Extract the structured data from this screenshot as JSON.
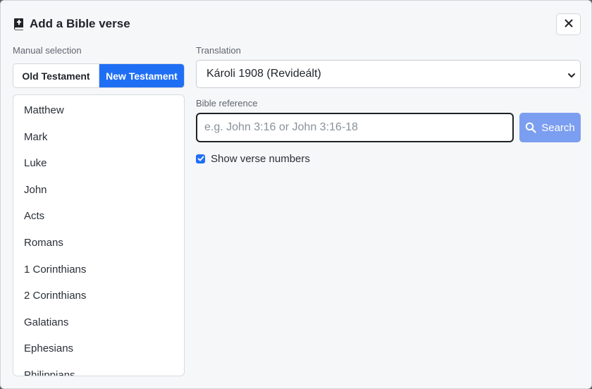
{
  "dialog": {
    "title": "Add a Bible verse",
    "title_icon": "bible-book-icon",
    "close_icon": "close-icon"
  },
  "manual_selection": {
    "label": "Manual selection",
    "tabs": [
      {
        "label": "Old Testament",
        "active": false
      },
      {
        "label": "New Testament",
        "active": true
      }
    ],
    "books": [
      "Matthew",
      "Mark",
      "Luke",
      "John",
      "Acts",
      "Romans",
      "1 Corinthians",
      "2 Corinthians",
      "Galatians",
      "Ephesians",
      "Philippians"
    ]
  },
  "translation": {
    "label": "Translation",
    "selected": "Károli 1908 (Revideált)"
  },
  "reference": {
    "label": "Bible reference",
    "value": "",
    "placeholder": "e.g. John 3:16 or John 3:16-18",
    "search_label": "Search",
    "search_icon": "search-icon"
  },
  "options": {
    "show_verse_numbers_label": "Show verse numbers",
    "show_verse_numbers": true
  },
  "colors": {
    "accent": "#1f6ff5",
    "search_button": "#7c9ef0"
  }
}
